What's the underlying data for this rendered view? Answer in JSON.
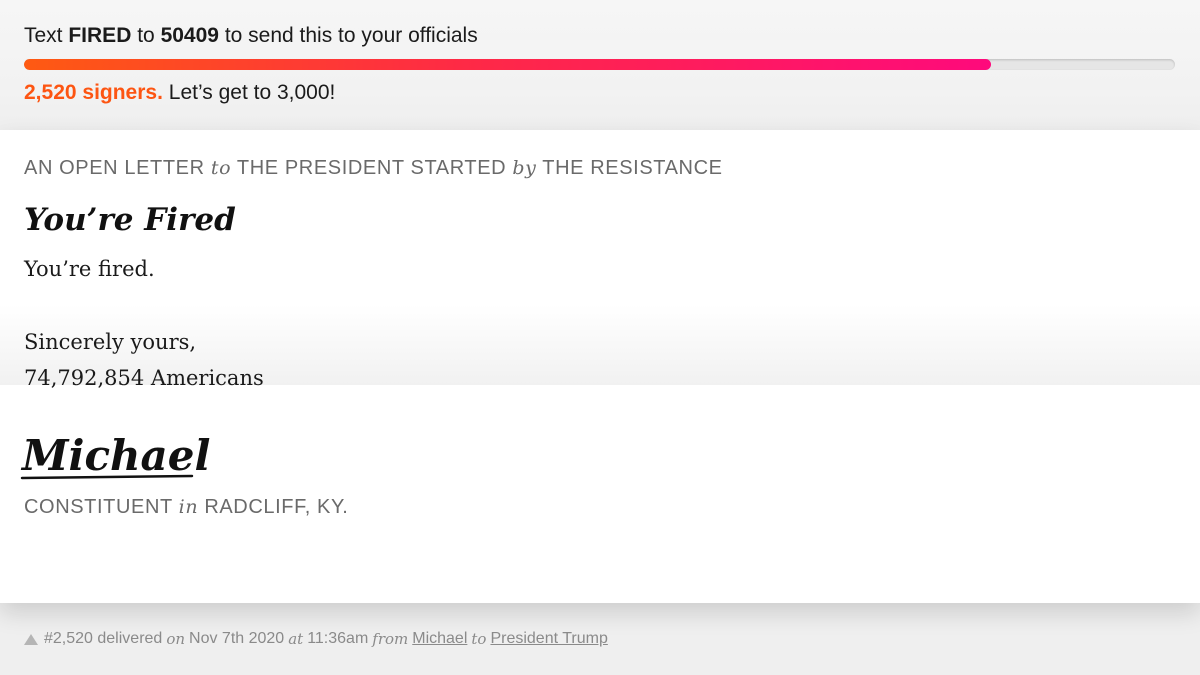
{
  "cta": {
    "prefix": "Text",
    "keyword": "FIRED",
    "mid": "to",
    "number": "50409",
    "suffix": "to send this to your officials"
  },
  "progress": {
    "fraction": 0.84,
    "count_label": "2,520 signers.",
    "goal_label": "Let’s get to 3,000!"
  },
  "colors": {
    "accent_orange": "#fd5512",
    "accent_pink": "#fe0a7c"
  },
  "letter": {
    "kicker_a": "AN OPEN LETTER",
    "kicker_to": "to",
    "kicker_b": "THE PRESIDENT STARTED",
    "kicker_by": "by",
    "kicker_c": "THE RESISTANCE",
    "title": "You’re Fired",
    "body": "You’re fired.",
    "closing": "Sincerely yours,",
    "signers_line": "74,792,854 Americans"
  },
  "signature": {
    "name": "Michael",
    "role": "CONSTITUENT",
    "in_word": "in",
    "place": "RADCLIFF, KY."
  },
  "footer": {
    "icon": "triangle-up-icon",
    "delivered": "#2,520 delivered",
    "on_word": "on",
    "date": "Nov 7th 2020",
    "at_word": "at",
    "time": "11:36am",
    "from_word": "from",
    "from_name": "Michael",
    "to_word": "to",
    "to_name": "President Trump"
  }
}
